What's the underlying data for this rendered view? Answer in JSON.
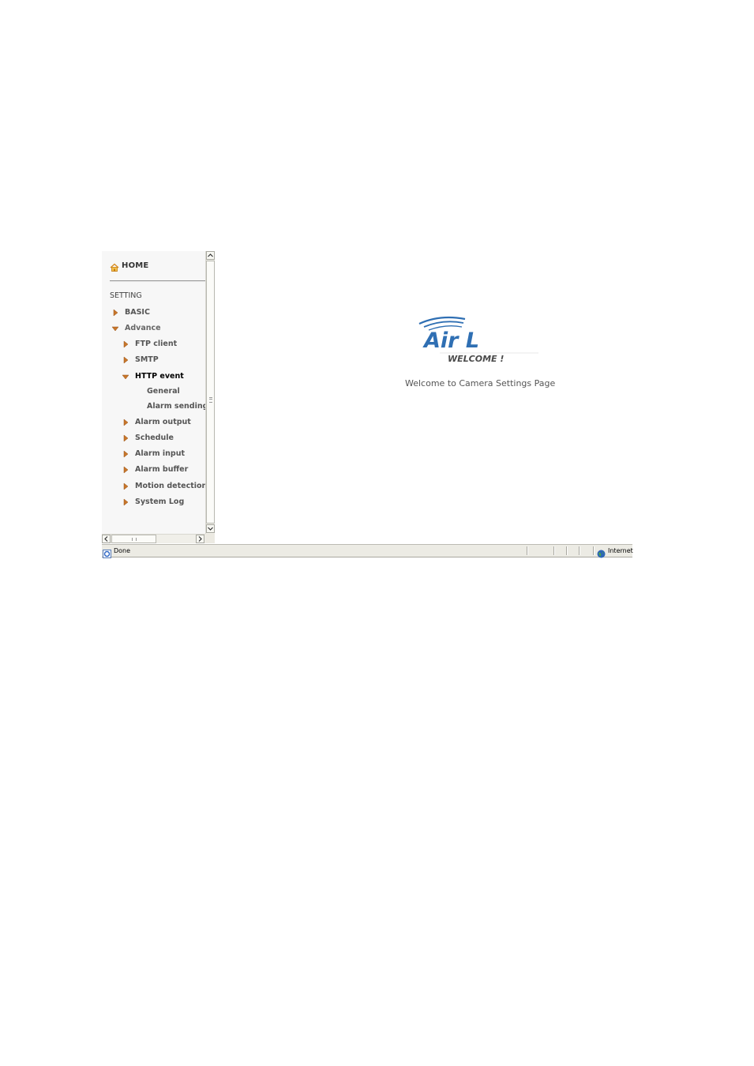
{
  "nav": {
    "home_label": "HOME",
    "section_label": "SETTING",
    "basic_label": "BASIC",
    "advance_label": "Advance",
    "items": [
      {
        "label": "FTP client"
      },
      {
        "label": "SMTP"
      },
      {
        "label": "HTTP event"
      },
      {
        "label": "Alarm output"
      },
      {
        "label": "Schedule"
      },
      {
        "label": "Alarm input"
      },
      {
        "label": "Alarm buffer"
      },
      {
        "label": "Motion detection"
      },
      {
        "label": "System Log"
      }
    ],
    "http_sub": [
      {
        "label": "General"
      },
      {
        "label": "Alarm sending"
      }
    ]
  },
  "main": {
    "logo_text": "Air L",
    "logo_tagline": "WELCOME !",
    "welcome_message": "Welcome to Camera Settings Page"
  },
  "status_bar": {
    "status_text": "Done",
    "zone_text": "Internet"
  },
  "colors": {
    "logo_blue": "#2f6fb3",
    "nav_arrow": "#c8762a"
  }
}
